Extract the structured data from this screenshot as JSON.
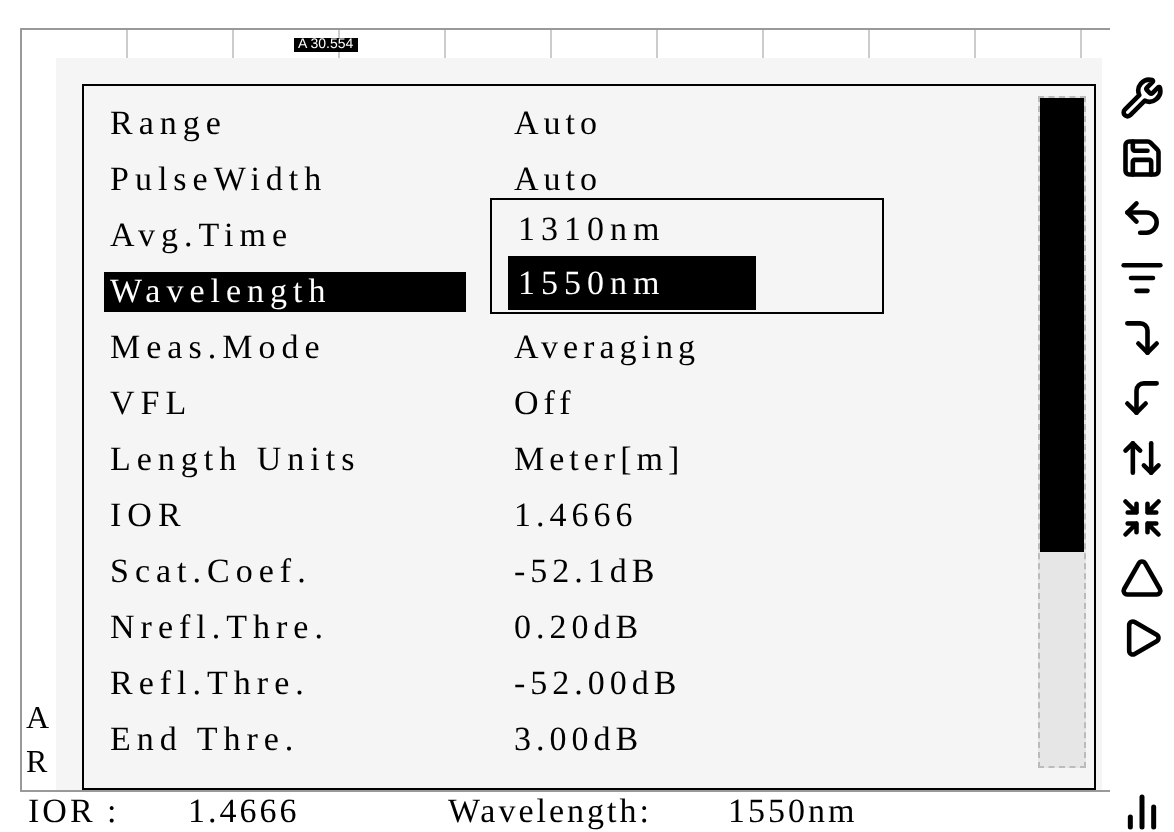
{
  "marker_label": "A 30.554",
  "side_letters": [
    "A",
    "R"
  ],
  "params": [
    {
      "label": "Range",
      "value": "Auto",
      "selected": false
    },
    {
      "label": "PulseWidth",
      "value": "Auto",
      "selected": false
    },
    {
      "label": "Avg.Time",
      "selected": false
    },
    {
      "label": "Wavelength",
      "selected": true
    },
    {
      "label": "Meas.Mode",
      "value": "Averaging",
      "selected": false
    },
    {
      "label": "VFL",
      "value": "Off",
      "selected": false
    },
    {
      "label": "Length Units",
      "value": "Meter[m]",
      "selected": false
    },
    {
      "label": "IOR",
      "value": "1.4666",
      "selected": false
    },
    {
      "label": "Scat.Coef.",
      "value": "-52.1dB",
      "selected": false
    },
    {
      "label": "Nrefl.Thre.",
      "value": "0.20dB",
      "selected": false
    },
    {
      "label": "Refl.Thre.",
      "value": "-52.00dB",
      "selected": false
    },
    {
      "label": "End Thre.",
      "value": "3.00dB",
      "selected": false
    }
  ],
  "dropdown": {
    "options": [
      {
        "label": "1310nm",
        "selected": false
      },
      {
        "label": "1550nm",
        "selected": true
      }
    ]
  },
  "status_bar": [
    "IOR :",
    "1.4666",
    "Wavelength:",
    "1550nm"
  ]
}
